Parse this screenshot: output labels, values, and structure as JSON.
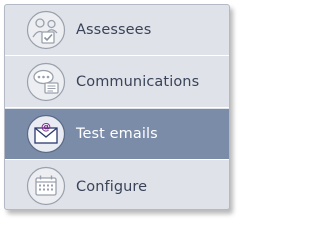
{
  "menu": {
    "items": [
      {
        "label": "Assessees",
        "icon": "assessees-icon"
      },
      {
        "label": "Communications",
        "icon": "communications-icon"
      },
      {
        "label": "Test emails",
        "icon": "email-icon",
        "active": true
      },
      {
        "label": "Configure",
        "icon": "calendar-icon"
      }
    ]
  },
  "colors": {
    "panel_bg": "#dfe2e8",
    "active_bg": "#7b8ca9",
    "label_text": "#3a4358",
    "active_text": "#ffffff"
  }
}
